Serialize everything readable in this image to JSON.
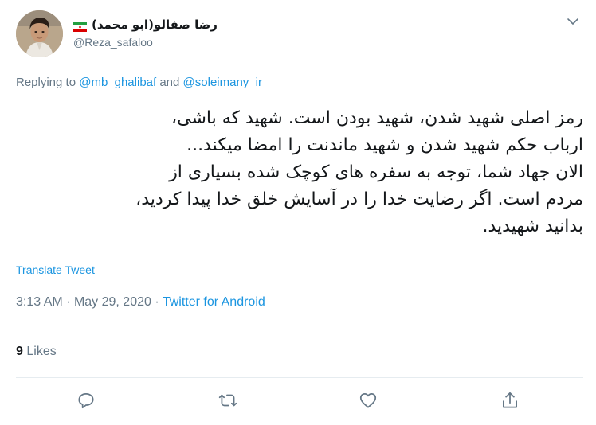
{
  "user": {
    "display_name": "رضا صفالو(ابو محمد)",
    "handle": "@Reza_safaloo",
    "flag_icon": "iran-flag-icon"
  },
  "reply": {
    "prefix": "Replying to",
    "mention_1": "@mb_ghalibaf",
    "conjunction": "and",
    "mention_2": "@soleimany_ir"
  },
  "tweet": {
    "lines": [
      "رمز اصلی شهید شدن، شهید بودن است. شهید که باشی،",
      "ارباب حکم شهید شدن و شهید ماندنت را امضا میکند...",
      "الان جهاد شما، توجه به سفره های کوچک شده بسیاری از",
      "مردم است. اگر رضایت خدا را در آسایش خلق خدا پیدا کردید،",
      "بدانید شهیدید."
    ]
  },
  "translate_label": "Translate Tweet",
  "meta": {
    "time": "3:13 AM",
    "separator": "·",
    "date": "May 29, 2020",
    "source": "Twitter for Android"
  },
  "likes": {
    "count": "9",
    "label": "Likes"
  },
  "actions": [
    "reply-icon",
    "retweet-icon",
    "like-icon",
    "share-icon"
  ],
  "colors": {
    "link": "#1b95e0",
    "secondary": "#657786",
    "text": "#14171a",
    "divider": "#e6ecf0"
  }
}
